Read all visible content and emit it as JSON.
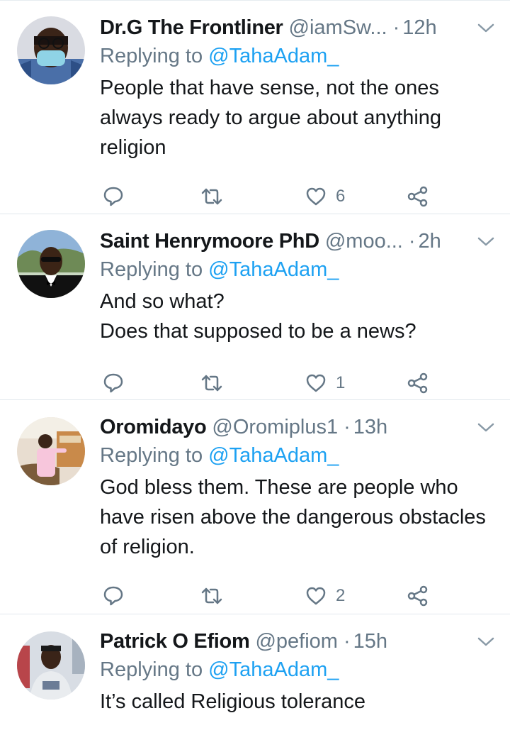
{
  "colors": {
    "text_primary": "#14171a",
    "text_secondary": "#657786",
    "link": "#1da1f2",
    "divider": "#e1e8ed"
  },
  "icons": {
    "reply": "reply-icon",
    "retweet": "retweet-icon",
    "like": "like-icon",
    "share": "share-icon",
    "more": "chevron-down-icon"
  },
  "tweets": [
    {
      "name": "Dr.G The Frontliner",
      "handle": "@iamSw...",
      "separator": "·",
      "time": "12h",
      "replying_prefix": "Replying to",
      "replying_to": "@TahaAdam_",
      "text": "People that have sense, not the ones always ready to argue about anything religion",
      "likes": "6"
    },
    {
      "name": "Saint Henrymoore PhD",
      "handle": "@moo...",
      "separator": "·",
      "time": "2h",
      "replying_prefix": "Replying to",
      "replying_to": "@TahaAdam_",
      "text": "And so what?\nDoes that supposed to be a news?",
      "likes": "1"
    },
    {
      "name": "Oromidayo",
      "handle": "@Oromiplus1",
      "separator": "·",
      "time": "13h",
      "replying_prefix": "Replying to",
      "replying_to": "@TahaAdam_",
      "text": "God bless them. These are people who have risen above the dangerous obstacles of religion.",
      "likes": "2"
    },
    {
      "name": "Patrick O Efiom",
      "handle": "@pefiom",
      "separator": "·",
      "time": "15h",
      "replying_prefix": "Replying to",
      "replying_to": "@TahaAdam_",
      "text": "It’s called Religious tolerance",
      "likes": ""
    }
  ]
}
